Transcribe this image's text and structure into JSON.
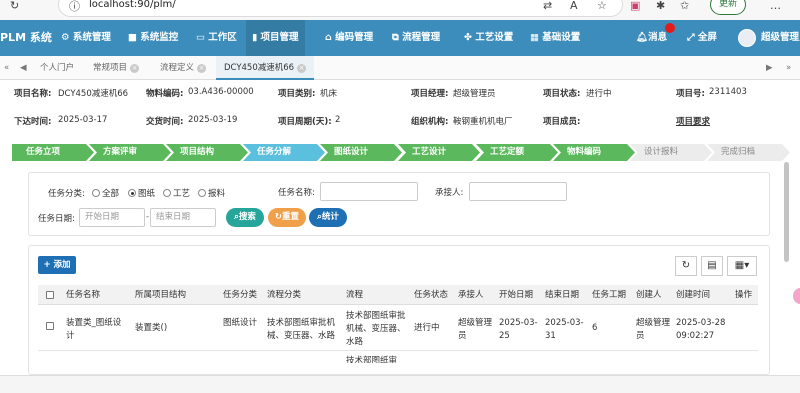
{
  "browser": {
    "url": "localhost:90/plm/",
    "update_label": "更新",
    "icons": [
      "info-icon",
      "translate-icon",
      "read-aloud-icon",
      "favorite-icon",
      "collections-icon",
      "extensions-icon",
      "split-screen-icon",
      "favorites-bar-icon",
      "more-icon"
    ]
  },
  "nav": {
    "brand": "PLM 系统",
    "items": [
      {
        "label": "系统管理",
        "icon": "gear-icon"
      },
      {
        "label": "系统监控",
        "icon": "video-icon"
      },
      {
        "label": "工作区",
        "icon": "monitor-icon"
      },
      {
        "label": "项目管理",
        "icon": "book-icon"
      },
      {
        "label": "编码管理",
        "icon": "bank-icon"
      },
      {
        "label": "流程管理",
        "icon": "sitemap-icon"
      },
      {
        "label": "工艺设置",
        "icon": "paw-icon"
      },
      {
        "label": "基础设置",
        "icon": "grid-icon"
      }
    ],
    "messages": "消息",
    "fullscreen": "全屏",
    "user": "超级管理员"
  },
  "tabs": {
    "items": [
      "个人门户",
      "常规项目",
      "流程定义",
      "DCY450减速机66"
    ],
    "active_index": 3
  },
  "project": {
    "name_label": "项目名称:",
    "name": "DCY450减速机66",
    "material_label": "物料编码:",
    "material": "03.A436-00000",
    "category_label": "项目类别:",
    "category": "机床",
    "manager_label": "项目经理:",
    "manager": "超级管理员",
    "status_label": "项目状态:",
    "status": "进行中",
    "number_label": "项目号:",
    "number": "2311403",
    "issue_label": "下达时间:",
    "issue": "2025-03-17",
    "delivery_label": "交货时间:",
    "delivery": "2025-03-19",
    "period_label": "项目周期(天):",
    "period": "2",
    "org_label": "组织机构:",
    "org": "鞍钢重机机电厂",
    "members_label": "项目成员:",
    "members": "",
    "requirements_link": "项目要求"
  },
  "steps": [
    {
      "label": "任务立项",
      "state": "done"
    },
    {
      "label": "方案评审",
      "state": "done"
    },
    {
      "label": "项目结构",
      "state": "done"
    },
    {
      "label": "任务分解",
      "state": "current"
    },
    {
      "label": "图纸设计",
      "state": "done"
    },
    {
      "label": "工艺设计",
      "state": "done"
    },
    {
      "label": "工艺定额",
      "state": "done"
    },
    {
      "label": "物料编码",
      "state": "done"
    },
    {
      "label": "设计报料",
      "state": "todo"
    },
    {
      "label": "完成归档",
      "state": "todo"
    }
  ],
  "search": {
    "type_label": "任务分类:",
    "types": [
      "全部",
      "图纸",
      "工艺",
      "报料"
    ],
    "selected_type": "图纸",
    "name_label": "任务名称:",
    "name_value": "",
    "assignee_label": "承接人:",
    "assignee_value": "",
    "date_label": "任务日期:",
    "start_placeholder": "开始日期",
    "date_separator": "-",
    "end_placeholder": "结束日期",
    "search_button": "搜索",
    "reset_button": "重置",
    "stats_button": "统计"
  },
  "table": {
    "add_button": "+ 添加",
    "columns": [
      "任务名称",
      "所属项目结构",
      "任务分类",
      "流程分类",
      "流程",
      "任务状态",
      "承接人",
      "开始日期",
      "结束日期",
      "任务工期",
      "创建人",
      "创建时间",
      "操作"
    ],
    "rows": [
      {
        "task_name": "装置类_图纸设计",
        "structure": "装置类()",
        "category": "图纸设计",
        "flow_category": "技术部图纸审批机械、变压器、水路",
        "flow": "技术部图纸审批机械、变压器、水路",
        "status": "进行中",
        "assignee": "超级管理员",
        "start": "2025-03-25",
        "end": "2025-03-31",
        "duration": "6",
        "creator": "超级管理员",
        "created": "2025-03-28 09:02:27",
        "action": ""
      },
      {
        "task_name": "",
        "structure": "",
        "category": "",
        "flow_category": "",
        "flow": "技术部图纸审",
        "status": "",
        "assignee": "",
        "start": "",
        "end": "",
        "duration": "",
        "creator": "",
        "created": "",
        "action": ""
      }
    ]
  },
  "colors": {
    "nav": "#3c8dbc",
    "step_done": "#5cb85c",
    "step_current": "#5bc0de",
    "search_btn": "#26a69a",
    "reset_btn": "#f0a04b",
    "stats_btn": "#1f6fb5"
  }
}
